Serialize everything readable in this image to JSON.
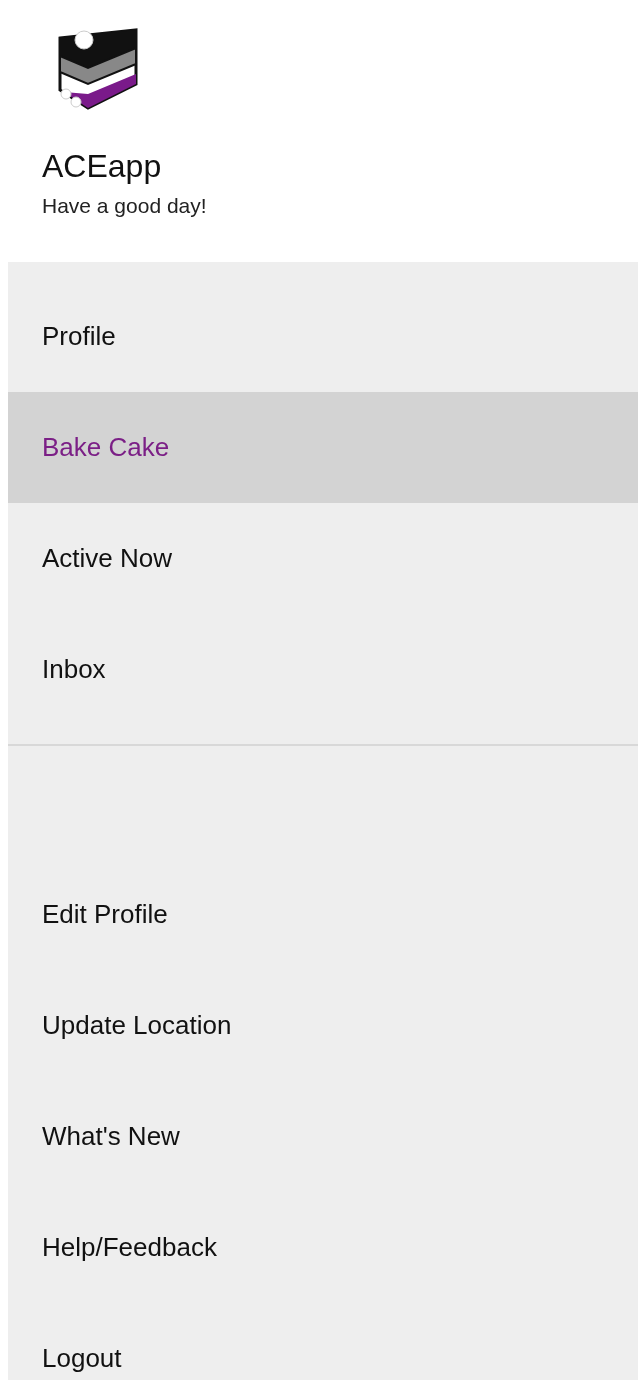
{
  "header": {
    "app_name": "ACEapp",
    "greeting": "Have a good day!"
  },
  "menu_sections": [
    {
      "items": [
        {
          "label": "Profile",
          "selected": false
        },
        {
          "label": "Bake Cake",
          "selected": true
        },
        {
          "label": "Active Now",
          "selected": false
        },
        {
          "label": "Inbox",
          "selected": false
        }
      ]
    },
    {
      "items": [
        {
          "label": "Edit Profile",
          "selected": false
        },
        {
          "label": "Update Location",
          "selected": false
        },
        {
          "label": "What's New",
          "selected": false
        },
        {
          "label": "Help/Feedback",
          "selected": false
        },
        {
          "label": "Logout",
          "selected": false
        }
      ]
    }
  ]
}
